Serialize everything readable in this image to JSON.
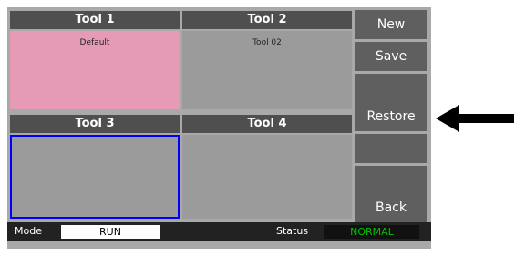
{
  "tools": [
    {
      "title": "Tool 1",
      "text": "Default"
    },
    {
      "title": "Tool 2",
      "text": "Tool 02"
    },
    {
      "title": "Tool 3",
      "text": ""
    },
    {
      "title": "Tool 4",
      "text": ""
    }
  ],
  "sidebar": {
    "new_label": "New",
    "save_label": "Save",
    "restore_label": "Restore",
    "back_label": "Back"
  },
  "statusbar": {
    "mode_label": "Mode",
    "mode_value": "RUN",
    "status_label": "Status",
    "status_value": "NORMAL"
  },
  "colors": {
    "active_tool": "#e59ab5",
    "selection_border": "#0000ff",
    "status_ok": "#00c000"
  },
  "annotation": {
    "pointer_icon": "left-arrow-icon"
  }
}
